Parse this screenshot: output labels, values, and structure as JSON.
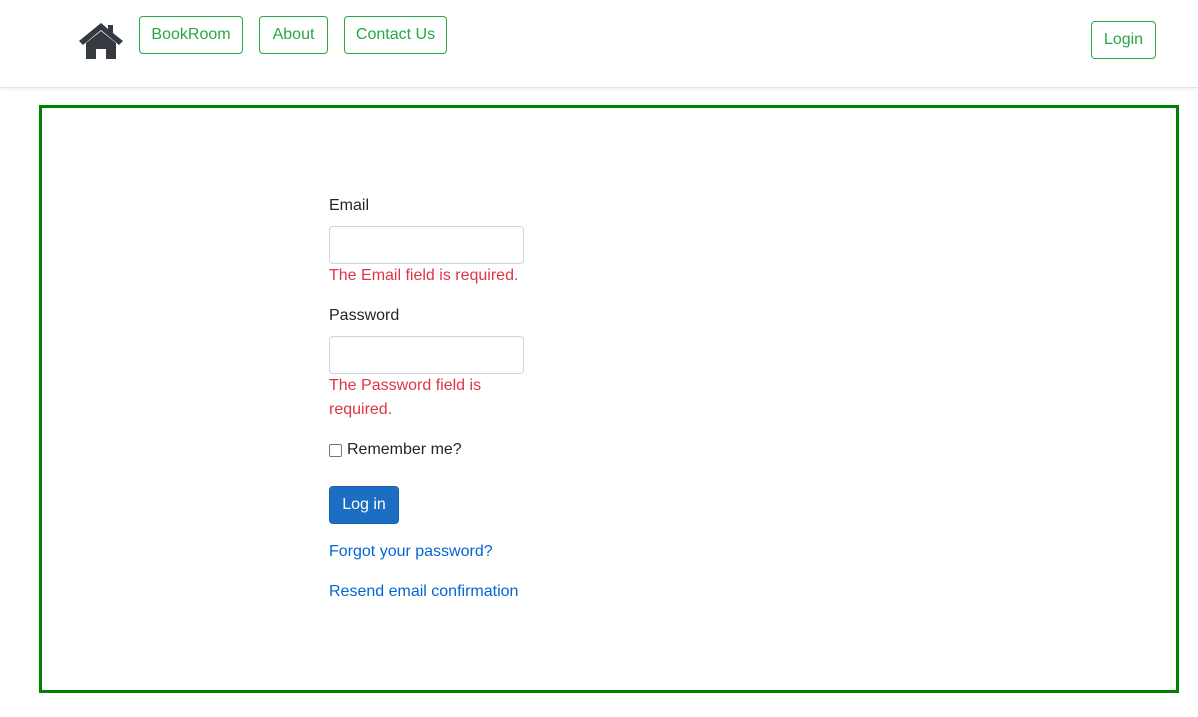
{
  "navbar": {
    "home_icon": "home-icon",
    "links": [
      "BookRoom",
      "About",
      "Contact Us"
    ],
    "login_label": "Login"
  },
  "form": {
    "email_label": "Email",
    "email_value": "",
    "email_error": "The Email field is required.",
    "password_label": "Password",
    "password_value": "",
    "password_error": "The Password field is required.",
    "remember_label": "Remember me?",
    "remember_checked": false,
    "submit_label": "Log in",
    "forgot_link": "Forgot your password?",
    "resend_link": "Resend email confirmation"
  },
  "colors": {
    "accent_green": "#28a745",
    "border_green": "#008000",
    "primary_blue": "#1b6ec2",
    "link_blue": "#0366d6",
    "error_red": "#dc3545"
  }
}
